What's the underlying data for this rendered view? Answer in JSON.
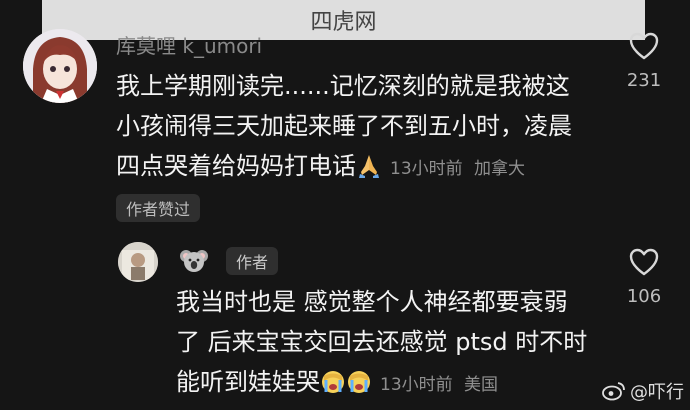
{
  "watermark_top": "四虎网",
  "comment1": {
    "username": "库莫哩 k_umori",
    "lines": [
      "我上学期刚读完......记忆深刻的就是我被这",
      "小孩闹得三天加起来睡了不到五小时，凌晨",
      "四点哭着给妈妈打电话"
    ],
    "time": "13小时前",
    "location": "加拿大",
    "like_count": "231",
    "author_liked_label": "作者赞过"
  },
  "reply": {
    "author_label": "作者",
    "lines": [
      "我当时也是 感觉整个人神经都要衰弱",
      "了 后来宝宝交回去还感觉 ptsd 时不时",
      "能听到娃娃哭"
    ],
    "time": "13小时前",
    "location": "美国",
    "like_count": "106"
  },
  "watermark_bottom": "@吓行",
  "icons": {
    "like": "heart-outline-icon",
    "pray": "folded-hands-emoji",
    "cry": "crying-face-emoji",
    "koala": "koala-emoji",
    "weibo": "weibo-logo"
  }
}
